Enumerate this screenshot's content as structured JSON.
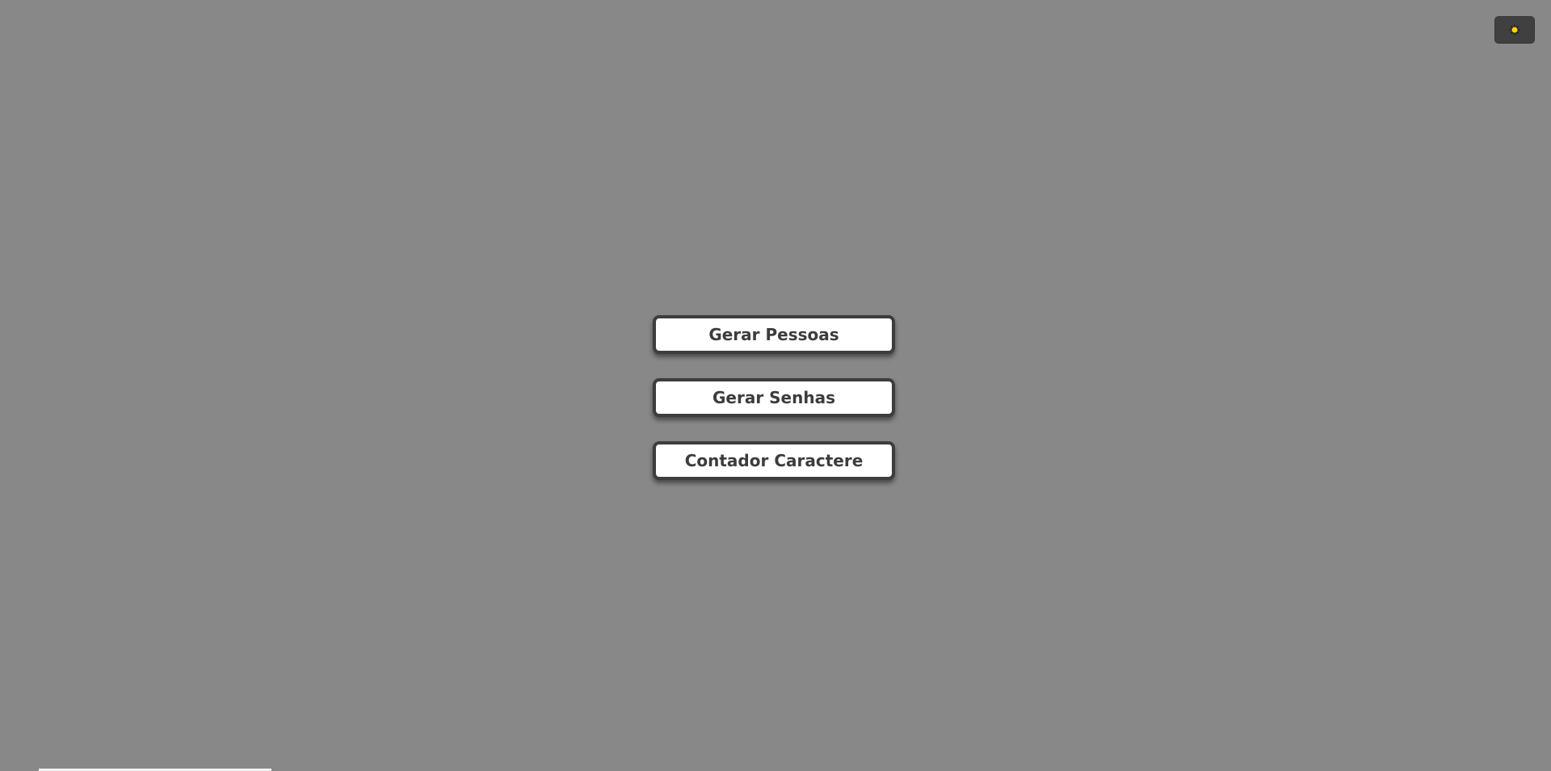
{
  "colors": {
    "background": "#888888",
    "button_bg": "#ffffff",
    "button_border": "#3d3d3d",
    "button_text": "#3c3c3c",
    "toggle_bg": "#404040",
    "sun": "#ffd400"
  },
  "theme_toggle": {
    "icon": "sun-icon"
  },
  "menu": {
    "buttons": [
      {
        "label": "Gerar Pessoas"
      },
      {
        "label": "Gerar Senhas"
      },
      {
        "label": "Contador Caractere"
      }
    ]
  }
}
